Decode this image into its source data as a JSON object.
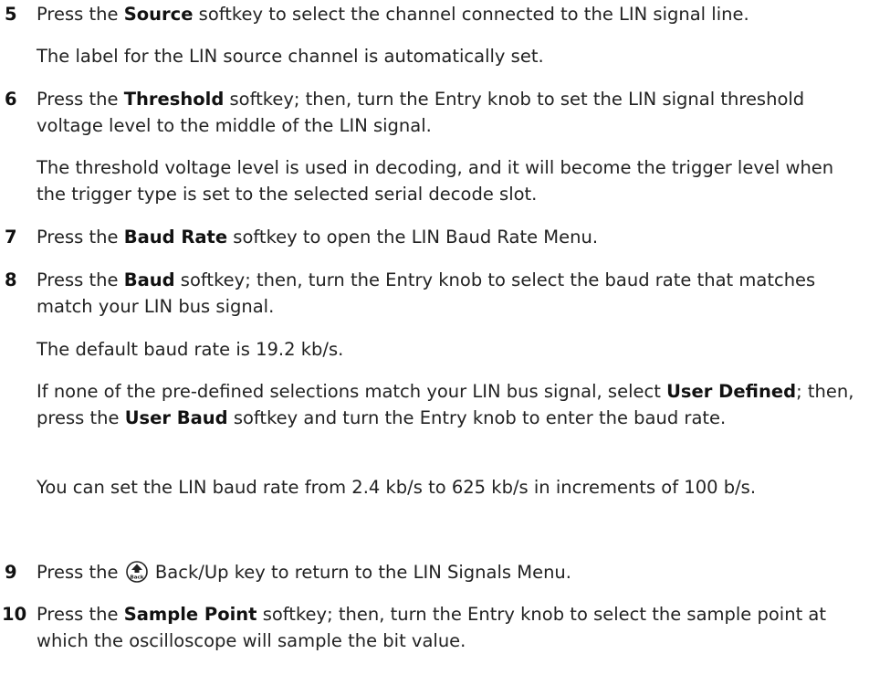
{
  "steps": [
    {
      "number": "5",
      "parts": [
        "Press the ",
        "Source",
        " softkey to select the channel connected to the LIN signal line."
      ],
      "notes": [
        "The label for the LIN source channel is automatically set."
      ]
    },
    {
      "number": "6",
      "parts": [
        "Press the ",
        "Threshold",
        " softkey; then, turn the Entry knob to set the LIN signal threshold voltage level to the middle of the LIN signal."
      ],
      "notes": [
        "The threshold voltage level is used in decoding, and it will become the trigger level when the trigger type is set to the selected serial decode slot."
      ]
    },
    {
      "number": "7",
      "parts": [
        "Press the ",
        "Baud Rate",
        " softkey to open the LIN Baud Rate Menu."
      ]
    },
    {
      "number": "8",
      "parts": [
        "Press the ",
        "Baud",
        " softkey; then, turn the Entry knob to select the baud rate that matches match your LIN bus signal."
      ],
      "notes": [
        "The default baud rate is 19.2 kb/s.",
        "You can set the LIN baud rate from 2.4 kb/s to 625 kb/s in increments of 100 b/s."
      ],
      "user_defined_note": {
        "t1": "If none of the pre-defined selections match your LIN bus signal, select ",
        "b1": "User Defined",
        "t2": "; then, press the ",
        "b2": "User Baud",
        "t3": " softkey and turn the Entry knob to enter the baud rate."
      }
    },
    {
      "number": "9",
      "before_icon": "Press the ",
      "icon": "back-up-key-icon",
      "icon_label": "Back",
      "after_icon": " Back/Up key to return to the LIN Signals Menu."
    },
    {
      "number": "10",
      "parts": [
        "Press the ",
        "Sample Point",
        " softkey; then, turn the Entry knob to select the sample point at which the oscilloscope will sample the bit value."
      ]
    }
  ]
}
